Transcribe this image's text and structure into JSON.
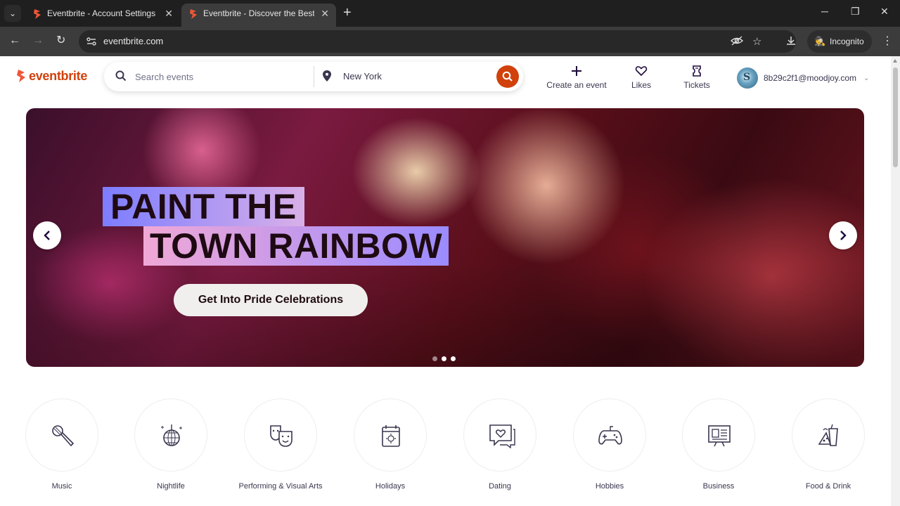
{
  "browser": {
    "tabs": [
      {
        "title": "Eventbrite - Account Settings",
        "active": false
      },
      {
        "title": "Eventbrite - Discover the Best Local Events & Things to Do",
        "active": true
      }
    ],
    "url": "eventbrite.com",
    "incognito_label": "Incognito"
  },
  "header": {
    "logo_text": "eventbrite",
    "search_placeholder": "Search events",
    "location": "New York",
    "nav": {
      "create_event": "Create an event",
      "likes": "Likes",
      "tickets": "Tickets"
    },
    "account_email": "8b29c2f1@moodjoy.com"
  },
  "hero": {
    "headline_line1": "PAINT THE",
    "headline_line2": "TOWN RAINBOW",
    "cta": "Get Into Pride Celebrations",
    "slides_total": 3,
    "active_slide": 2
  },
  "categories": [
    {
      "label": "Music",
      "icon": "microphone-icon"
    },
    {
      "label": "Nightlife",
      "icon": "disco-ball-icon"
    },
    {
      "label": "Performing & Visual Arts",
      "icon": "theater-masks-icon"
    },
    {
      "label": "Holidays",
      "icon": "calendar-icon"
    },
    {
      "label": "Dating",
      "icon": "heart-chat-icon"
    },
    {
      "label": "Hobbies",
      "icon": "gamepad-icon"
    },
    {
      "label": "Business",
      "icon": "presentation-board-icon"
    },
    {
      "label": "Food & Drink",
      "icon": "food-drink-icon"
    }
  ],
  "colors": {
    "brand": "#d1410c",
    "text": "#39364f"
  }
}
